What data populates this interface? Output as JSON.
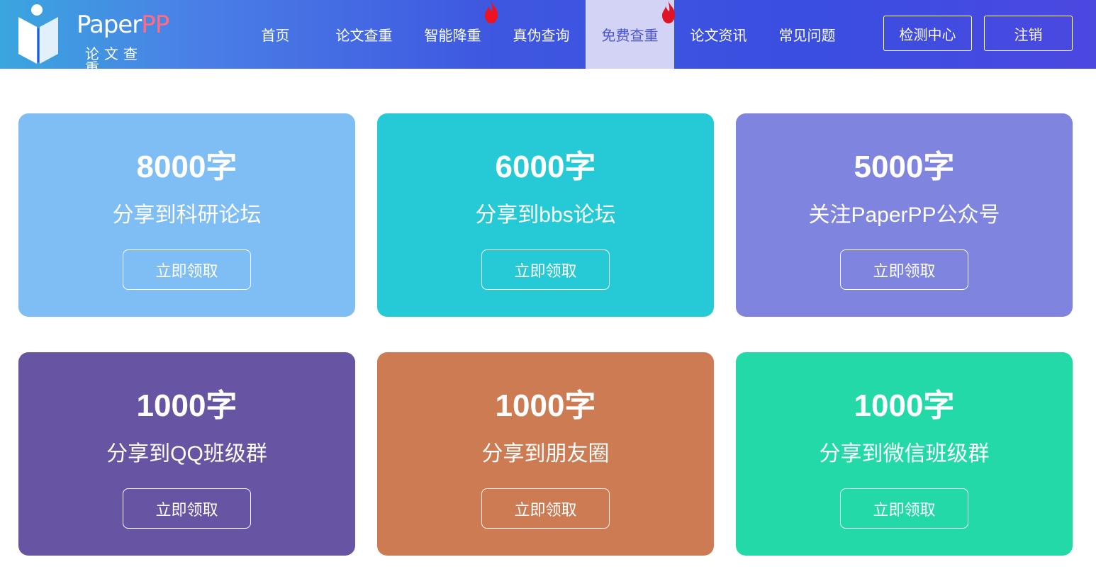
{
  "header": {
    "logo": {
      "brand_a": "Paper",
      "brand_b": "PP",
      "subtitle": "论文查重"
    },
    "nav": [
      {
        "label": "首页"
      },
      {
        "label": "论文查重"
      },
      {
        "label": "智能降重",
        "hot": true
      },
      {
        "label": "真伪查询"
      },
      {
        "label": "免费查重",
        "hot": true,
        "active": true
      },
      {
        "label": "论文资讯"
      },
      {
        "label": "常见问题"
      }
    ],
    "buttons": {
      "center": "检测中心",
      "logout": "注销"
    }
  },
  "cards": [
    {
      "amount": "8000字",
      "desc": "分享到科研论坛",
      "button": "立即领取",
      "color": "#7fbef4"
    },
    {
      "amount": "6000字",
      "desc": "分享到bbs论坛",
      "button": "立即领取",
      "color": "#25cad6"
    },
    {
      "amount": "5000字",
      "desc": "关注PaperPP公众号",
      "button": "立即领取",
      "color": "#7f84de"
    },
    {
      "amount": "1000字",
      "desc": "分享到QQ班级群",
      "button": "立即领取",
      "color": "#6755a3"
    },
    {
      "amount": "1000字",
      "desc": "分享到朋友圈",
      "button": "立即领取",
      "color": "#cc7b52"
    },
    {
      "amount": "1000字",
      "desc": "分享到微信班级群",
      "button": "立即领取",
      "color": "#22d9a7"
    }
  ],
  "icons": {
    "hot_badge": "flame-icon",
    "logo_mark": "book-icon"
  }
}
